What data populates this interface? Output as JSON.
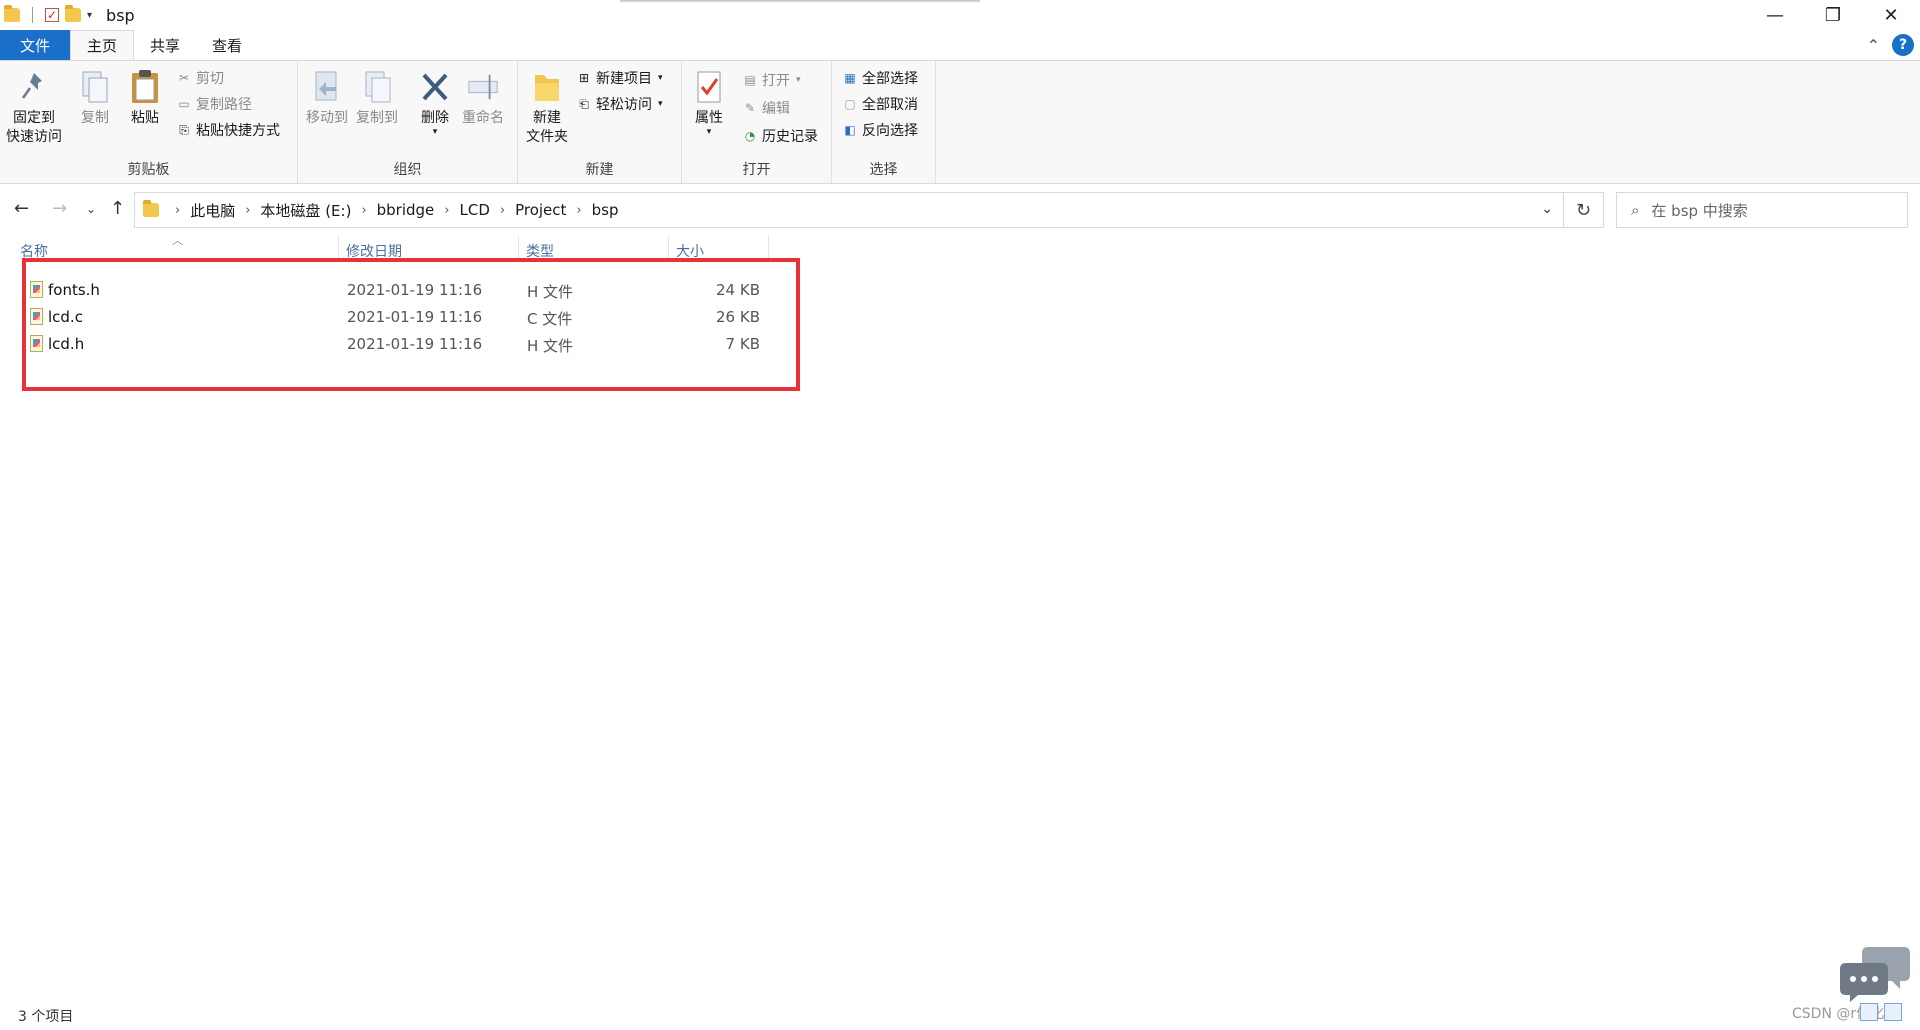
{
  "window": {
    "title": "bsp",
    "controls": {
      "minimize": "—",
      "restore": "❐",
      "close": "✕"
    }
  },
  "ribbon_tabs": [
    "文件",
    "主页",
    "共享",
    "查看"
  ],
  "ribbon": {
    "clipboard": {
      "label": "剪贴板",
      "pin": "固定到\n快速访问",
      "pin_line1": "固定到",
      "pin_line2": "快速访问",
      "copy": "复制",
      "paste": "粘贴",
      "cut": "剪切",
      "copy_path": "复制路径",
      "paste_shortcut": "粘贴快捷方式"
    },
    "organize": {
      "label": "组织",
      "move_to": "移动到",
      "copy_to": "复制到",
      "delete": "删除",
      "rename": "重命名"
    },
    "new": {
      "label": "新建",
      "new_folder_line1": "新建",
      "new_folder_line2": "文件夹",
      "new_item": "新建项目",
      "easy_access": "轻松访问"
    },
    "open": {
      "label": "打开",
      "properties": "属性",
      "open": "打开",
      "edit": "编辑",
      "history": "历史记录"
    },
    "select": {
      "label": "选择",
      "select_all": "全部选择",
      "select_none": "全部取消",
      "invert": "反向选择"
    }
  },
  "address": {
    "breadcrumbs": [
      "此电脑",
      "本地磁盘 (E:)",
      "bbridge",
      "LCD",
      "Project",
      "bsp"
    ],
    "search_placeholder": "在 bsp 中搜索"
  },
  "columns": [
    "名称",
    "修改日期",
    "类型",
    "大小"
  ],
  "files": [
    {
      "name": "fonts.h",
      "date": "2021-01-19 11:16",
      "type": "H 文件",
      "size": "24 KB"
    },
    {
      "name": "lcd.c",
      "date": "2021-01-19 11:16",
      "type": "C 文件",
      "size": "26 KB"
    },
    {
      "name": "lcd.h",
      "date": "2021-01-19 11:16",
      "type": "H 文件",
      "size": "7 KB"
    }
  ],
  "status": {
    "item_count": "3 个项目",
    "watermark": "CSDN @r优化"
  },
  "colors": {
    "file_tab": "#1a6fc9",
    "highlight_box": "#e8323a"
  }
}
